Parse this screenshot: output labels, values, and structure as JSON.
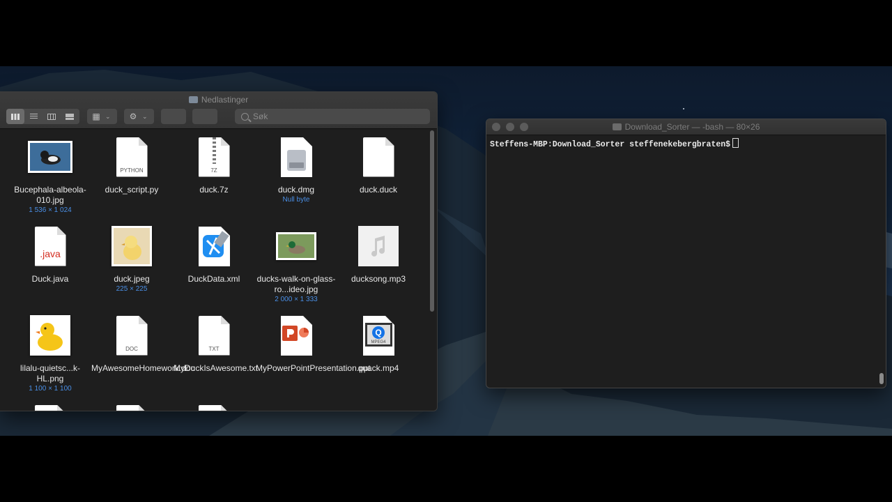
{
  "finder": {
    "title": "Nedlastinger",
    "search_placeholder": "Søk",
    "files": [
      {
        "name": "Bucephala-albeola-010.jpg",
        "meta": "1 536 × 1 024",
        "kind": "photo-bufflehead"
      },
      {
        "name": "duck_script.py",
        "meta": "",
        "kind": "doc",
        "doc_label": "PYTHON"
      },
      {
        "name": "duck.7z",
        "meta": "",
        "kind": "zip",
        "doc_label": "7Z"
      },
      {
        "name": "duck.dmg",
        "meta": "Null byte",
        "kind": "dmg"
      },
      {
        "name": "duck.duck",
        "meta": "",
        "kind": "doc",
        "doc_label": ""
      },
      {
        "name": "Duck.java",
        "meta": "",
        "kind": "java",
        "doc_label": ".java"
      },
      {
        "name": "duck.jpeg",
        "meta": "225 × 225",
        "kind": "photo-duckling"
      },
      {
        "name": "DuckData.xml",
        "meta": "",
        "kind": "xcode"
      },
      {
        "name": "ducks-walk-on-glass-ro...ideo.jpg",
        "meta": "2 000 × 1 333",
        "kind": "photo-mallard"
      },
      {
        "name": "ducksong.mp3",
        "meta": "",
        "kind": "music"
      },
      {
        "name": "lilalu-quietsc...k-HL.png",
        "meta": "1 100 × 1 100",
        "kind": "photo-rubberduck"
      },
      {
        "name": "MyAwesomeHomework.doc",
        "meta": "",
        "kind": "doc",
        "doc_label": "DOC"
      },
      {
        "name": "MyDuckIsAwesome.txt",
        "meta": "",
        "kind": "doc",
        "doc_label": "TXT"
      },
      {
        "name": "MyPowerPointPresentation.ppt",
        "meta": "",
        "kind": "ppt"
      },
      {
        "name": "quack.mp4",
        "meta": "",
        "kind": "video",
        "doc_label": "MPEG4"
      }
    ]
  },
  "terminal": {
    "title": "Download_Sorter — -bash — 80×26",
    "prompt": "Steffens-MBP:Download_Sorter steffenekebergbraten$"
  }
}
